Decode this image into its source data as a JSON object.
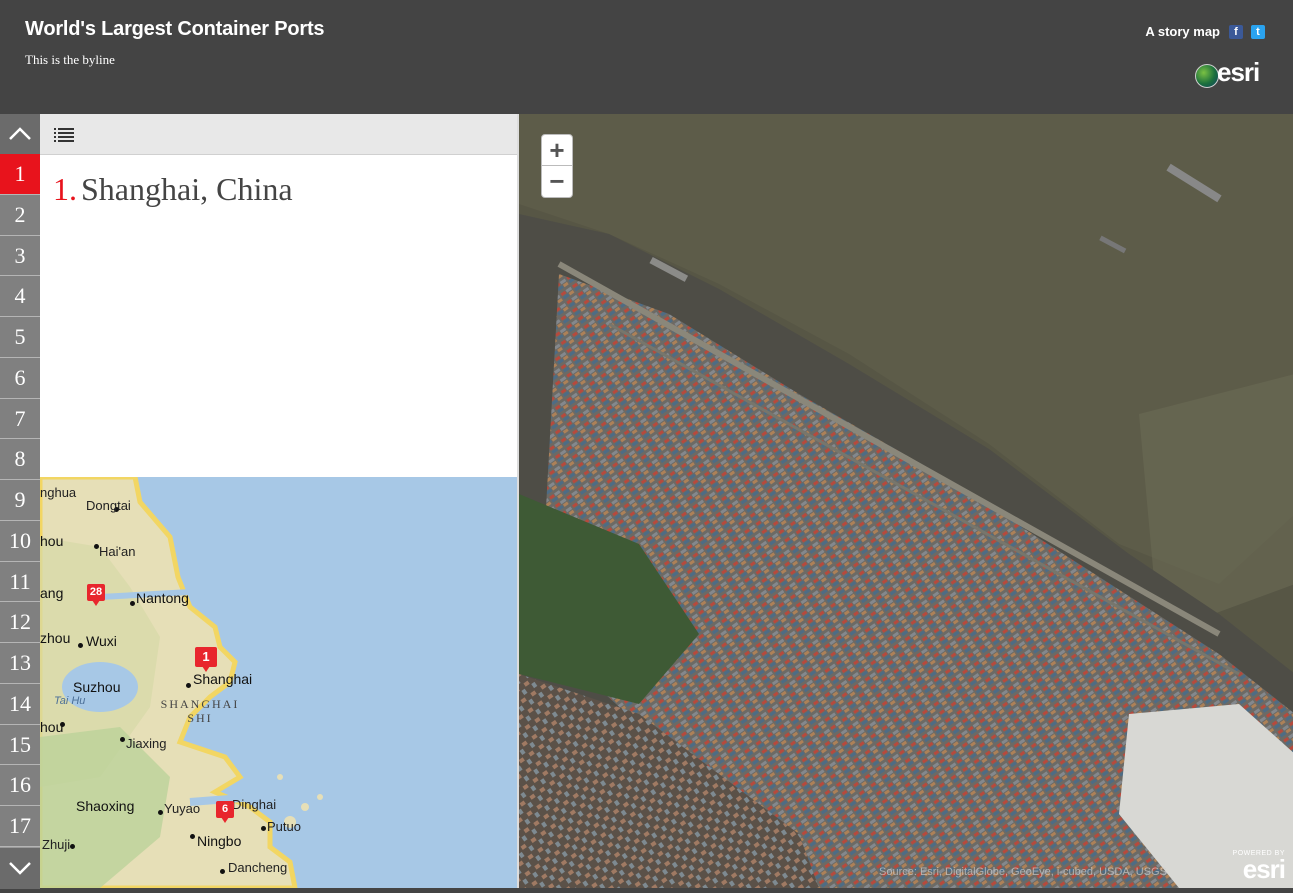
{
  "header": {
    "title": "World's Largest Container Ports",
    "byline": "This is the byline",
    "story_map_label": "A story map",
    "facebook_icon": "f",
    "twitter_icon": "t",
    "brand": "esri"
  },
  "sidebar": {
    "up_icon": "chevron-up-icon",
    "down_icon": "chevron-down-icon",
    "active_index": 0,
    "items": [
      "1",
      "2",
      "3",
      "4",
      "5",
      "6",
      "7",
      "8",
      "9",
      "10",
      "11",
      "12",
      "13",
      "14",
      "15",
      "16",
      "17"
    ]
  },
  "panel": {
    "list_icon": "list-icon",
    "entry_number": "1.",
    "entry_title": "Shanghai, China"
  },
  "locator_map": {
    "labels": {
      "nghua": "nghua",
      "dongtai": "Dongtai",
      "hou": "hou",
      "haian": "Hai'an",
      "ang": "ang",
      "nantong": "Nantong",
      "zhou": "zhou",
      "wuxi": "Wuxi",
      "suzhou": "Suzhou",
      "shanghai": "Shanghai",
      "taihu": "Tai Hu",
      "shanghai_shi": "SHANGHAI SHI",
      "jiaxing": "Jiaxing",
      "shaoxing": "Shaoxing",
      "yuyao": "Yuyao",
      "dinghai": "Dinghai",
      "putuo": "Putuo",
      "zhuji": "Zhuji",
      "ningbo": "Ningbo",
      "dancheng": "Dancheng",
      "hou2": "hou"
    },
    "markers": [
      "28",
      "1",
      "6"
    ]
  },
  "main_map": {
    "zoom_in": "+",
    "zoom_out": "−",
    "attribution": "Source: Esri, DigitalGlobe, GeoEye, i-cubed, USDA, USGS",
    "powered_by": "POWERED BY",
    "brand": "esri"
  }
}
